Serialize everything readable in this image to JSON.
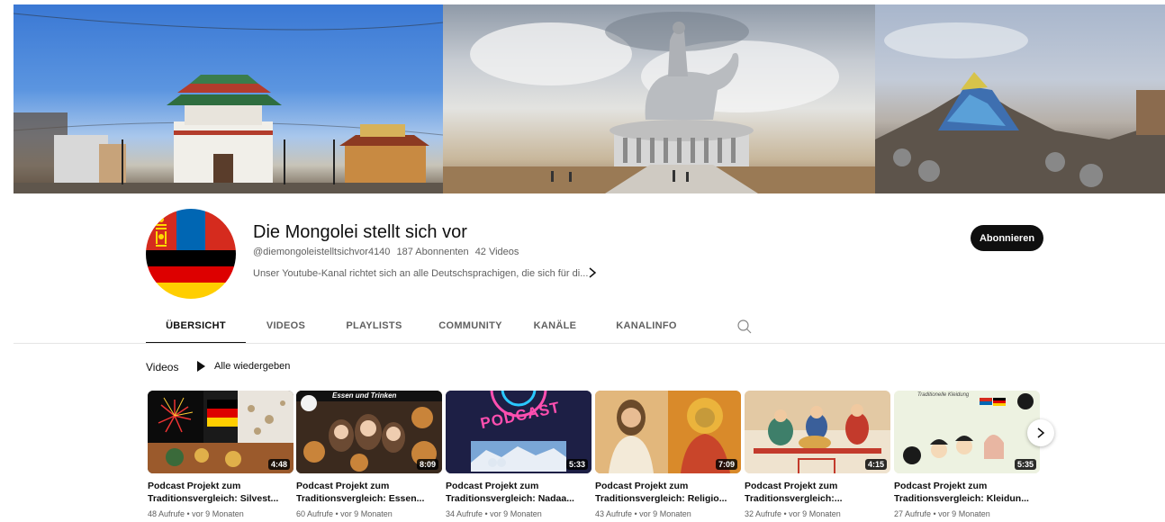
{
  "channel": {
    "name": "Die Mongolei stellt sich vor",
    "handle": "@diemongoleistelltsichvor4140",
    "subscribers": "187 Abonnenten",
    "video_count": "42 Videos",
    "description": "Unser Youtube-Kanal richtet sich an alle Deutschsprachigen, die sich für di...",
    "subscribe_label": "Abonnieren"
  },
  "tabs": [
    {
      "label": "ÜBERSICHT",
      "active": true
    },
    {
      "label": "VIDEOS",
      "active": false
    },
    {
      "label": "PLAYLISTS",
      "active": false
    },
    {
      "label": "COMMUNITY",
      "active": false
    },
    {
      "label": "KANÄLE",
      "active": false
    },
    {
      "label": "KANALINFO",
      "active": false
    }
  ],
  "section": {
    "title": "Videos",
    "play_all_label": "Alle wiedergeben"
  },
  "videos": [
    {
      "title_line1": "Podcast Projekt zum",
      "title_line2": "Traditionsvergleich: Silvest...",
      "duration": "4:48",
      "meta": "48 Aufrufe • vor 9 Monaten",
      "thumb_text": ""
    },
    {
      "title_line1": "Podcast Projekt zum",
      "title_line2": "Traditionsvergleich: Essen...",
      "duration": "8:09",
      "meta": "60 Aufrufe • vor 9 Monaten",
      "thumb_text": "Essen und Trinken"
    },
    {
      "title_line1": "Podcast Projekt zum",
      "title_line2": "Traditionsvergleich: Nadaa...",
      "duration": "5:33",
      "meta": "34 Aufrufe • vor 9 Monaten",
      "thumb_text": "PODCAST"
    },
    {
      "title_line1": "Podcast Projekt zum",
      "title_line2": "Traditionsvergleich: Religio...",
      "duration": "7:09",
      "meta": "43 Aufrufe • vor 9 Monaten",
      "thumb_text": ""
    },
    {
      "title_line1": "Podcast Projekt zum",
      "title_line2": "Traditionsvergleich:...",
      "duration": "4:15",
      "meta": "32 Aufrufe • vor 9 Monaten",
      "thumb_text": ""
    },
    {
      "title_line1": "Podcast Projekt zum",
      "title_line2": "Traditionsvergleich: Kleidun...",
      "duration": "5:35",
      "meta": "27 Aufrufe • vor 9 Monaten",
      "thumb_text": "Traditionelle Kleidung"
    }
  ],
  "icons": {
    "search": "search-icon",
    "next": "chevron-right-icon",
    "play": "play-icon",
    "desc_more": "chevron-right-icon"
  },
  "colors": {
    "subscribe_bg": "#0f0f0f",
    "flag_red": "#d52b1e",
    "flag_blue": "#0066b3",
    "flag_gold": "#ffd900"
  }
}
